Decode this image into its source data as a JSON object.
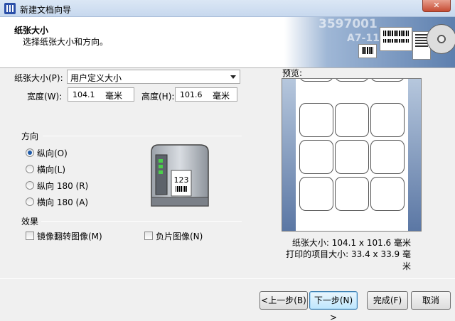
{
  "window": {
    "title": "新建文档向导",
    "close_label": "✕"
  },
  "header": {
    "title": "纸张大小",
    "subtitle": "选择纸张大小和方向。",
    "graphic_numbers": [
      "3597001",
      "A7-118"
    ]
  },
  "paper": {
    "size_label": "纸张大小(P):",
    "size_value": "用户定义大小",
    "width_label": "宽度(W):",
    "width_value": "104.1",
    "height_label": "高度(H):",
    "height_value": "101.6",
    "unit": "毫米"
  },
  "orientation": {
    "group_label": "方向",
    "options": [
      {
        "label": "纵向(O)",
        "checked": true
      },
      {
        "label": "横向(L)",
        "checked": false
      },
      {
        "label": "纵向 180 (R)",
        "checked": false
      },
      {
        "label": "横向 180 (A)",
        "checked": false
      }
    ]
  },
  "printer_label_text": "123",
  "effects": {
    "group_label": "效果",
    "mirror_label": "镜像翻转图像(M)",
    "negative_label": "负片图像(N)"
  },
  "preview": {
    "label": "预览:",
    "paper_size_text": "纸张大小: 104.1 x 101.6 毫米",
    "print_item_text": "打印的项目大小: 33.4 x 33.9 毫米"
  },
  "buttons": {
    "back": "<上一步(B)",
    "next": "下一步(N) >",
    "finish": "完成(F)",
    "cancel": "取消"
  },
  "colors": {
    "accent": "#1e5aa8",
    "preview_bg": "#5b77a4"
  }
}
